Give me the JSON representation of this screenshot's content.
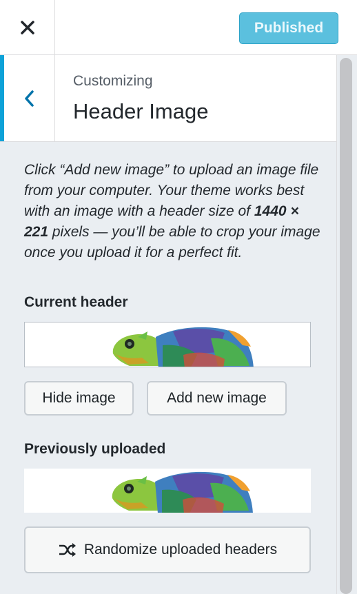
{
  "topbar": {
    "close_icon": "close-icon",
    "publish_label": "Published"
  },
  "section": {
    "back_icon": "chevron-left-icon",
    "breadcrumb": "Customizing",
    "title": "Header Image"
  },
  "description": {
    "part1": "Click “Add new image” to upload an image file from your computer. Your theme works best with an image with a header size of ",
    "size": "1440 × 221",
    "part2": " pixels — you’ll be able to crop your image once you upload it for a perfect fit."
  },
  "current_header": {
    "label": "Current header",
    "image": "chameleon-header-image"
  },
  "buttons": {
    "hide": "Hide image",
    "add": "Add new image"
  },
  "previously_uploaded": {
    "label": "Previously uploaded",
    "image": "chameleon-header-image",
    "randomize_icon": "shuffle-icon",
    "randomize_label": "Randomize uploaded headers"
  },
  "colors": {
    "accent": "#0ea2d8",
    "publish_bg": "#5bc0de",
    "panel_bg": "#eaeef2"
  }
}
